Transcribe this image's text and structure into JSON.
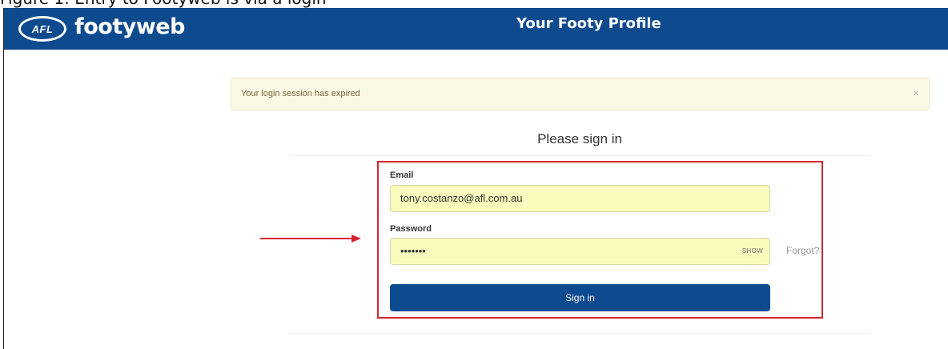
{
  "caption": {
    "text": "Figure 1: Entry to Footyweb is via a login"
  },
  "header": {
    "logo_text": "AFL",
    "brand": "footyweb",
    "title": "Your Footy Profile",
    "background": "#0e4a8e"
  },
  "alert": {
    "message": "Your login session has expired",
    "close_symbol": "×"
  },
  "signin": {
    "title": "Please sign in",
    "email_label": "Email",
    "email_value": "tony.costanzo@afl.com.au",
    "password_label": "Password",
    "password_masked": "•••••••",
    "show_label": "SHOW",
    "forgot_label": "Forgot?",
    "submit_label": "Sign in"
  },
  "annotations": {
    "highlight_color": "#d9232d",
    "arrow_icon": "arrow-right-icon"
  }
}
